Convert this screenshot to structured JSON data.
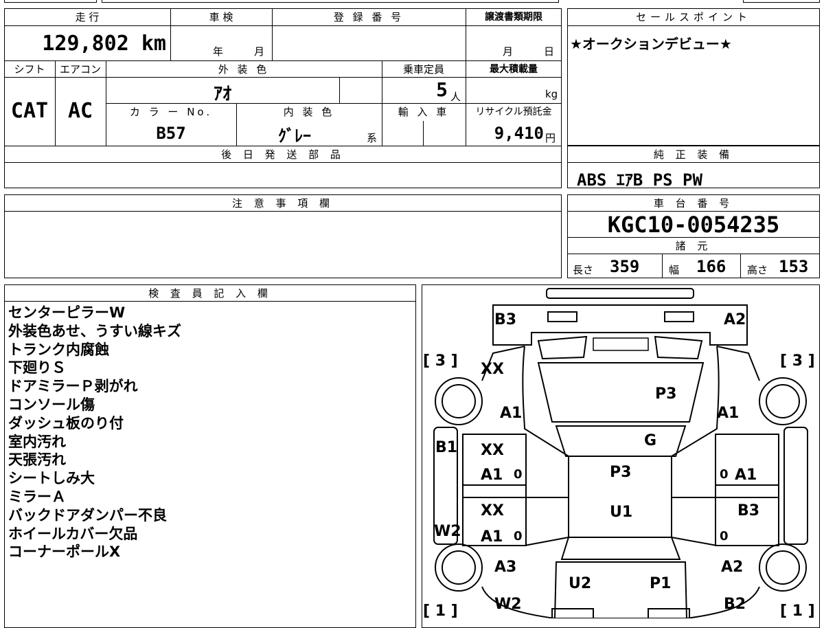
{
  "top_strip": {
    "partial_text": "..."
  },
  "mileage": {
    "label": "走 行",
    "value": "129,802 km"
  },
  "shaken": {
    "label": "車 検",
    "year": "年",
    "month": "月"
  },
  "registration": {
    "label": "登 録 番 号"
  },
  "transfer_deadline": {
    "label": "譲渡書類期限",
    "month": "月",
    "day": "日"
  },
  "sales_point": {
    "label": "セールスポイント",
    "text": "★オークションデビュー★"
  },
  "shift": {
    "label": "シフト",
    "value": "CAT"
  },
  "aircon": {
    "label": "エアコン",
    "value": "AC"
  },
  "exterior_color": {
    "label": "外 装 色",
    "value": "ｱｵ"
  },
  "capacity": {
    "label": "乗車定員",
    "value": "5",
    "unit": "人"
  },
  "max_load": {
    "label": "最大積載量",
    "unit": "kg"
  },
  "color_no": {
    "label": "カ ラ ー No.",
    "value": "B57"
  },
  "interior_color": {
    "label": "内 装 色",
    "value": "ｸﾞﾚｰ",
    "suffix": "系"
  },
  "import": {
    "label": "輸 入 車"
  },
  "recycle": {
    "label": "リサイクル預託金",
    "value": "9,410",
    "unit": "円"
  },
  "later_parts": {
    "label": "後 日 発 送 部 品"
  },
  "equipment": {
    "label": "純 正 装 備",
    "value": "ABS ｴｱB PS PW"
  },
  "caution": {
    "label": "注 意 事 項 欄"
  },
  "chassis": {
    "label": "車 台 番 号",
    "value": "KGC10-0054235"
  },
  "specs": {
    "label": "諸 元",
    "length_label": "長さ",
    "length": "359",
    "width_label": "幅",
    "width": "166",
    "height_label": "高さ",
    "height": "153"
  },
  "inspector": {
    "label": "検 査 員 記 入 欄",
    "notes": [
      "センターピラーW",
      "外装色あせ、うすい線キズ",
      "トランク内腐蝕",
      "下廻りＳ",
      "ドアミラーＰ剥がれ",
      "コンソール傷",
      "ダッシュ板のり付",
      "室内汚れ",
      "天張汚れ",
      "シートしみ大",
      "ミラーＡ",
      "バックドアダンパー不良",
      "ホイールカバー欠品",
      "コーナーポールX"
    ]
  },
  "diagram": {
    "marks": {
      "b3_top": "B3",
      "a2_top": "A2",
      "bracket_tl": "[ 3 ]",
      "bracket_tr": "[ 3 ]",
      "xx_1": "XX",
      "p3_hood": "P3",
      "a1_left_front": "A1",
      "a1_right_front": "A1",
      "g_windshield": "G",
      "b1_left": "B1",
      "xx_2": "XX",
      "a1_left_door1": "A1",
      "zero_1": "0",
      "p3_roof": "P3",
      "zero_2": "0",
      "a1_right_door1": "A1",
      "xx_3": "XX",
      "u1_roof": "U1",
      "b3_right": "B3",
      "w2_left": "W2",
      "a1_left_door2": "A1",
      "zero_3": "0",
      "zero_4": "0",
      "a3_left": "A3",
      "a2_right": "A2",
      "u2_rear": "U2",
      "p1_rear": "P1",
      "w2_bottom": "W2",
      "b2_bottom": "B2",
      "bracket_bl": "[ 1 ]",
      "bracket_br": "[ 1 ]"
    }
  }
}
